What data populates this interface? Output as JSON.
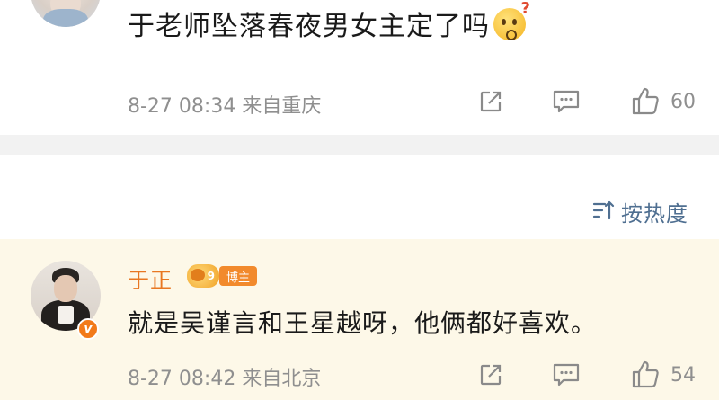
{
  "comments": [
    {
      "text": "于老师坠落春夜男女主定了吗",
      "emoji": "thinking-face-emoji",
      "meta": "8-27 08:34  来自重庆",
      "likes": "60"
    },
    {
      "user_name": "于正",
      "badge": "博主",
      "level_text": "9",
      "verified_text": "v",
      "text": "就是吴谨言和王星越呀，他俩都好喜欢。",
      "meta": "8-27 08:42  来自北京",
      "likes": "54"
    }
  ],
  "sort": {
    "label": "按热度"
  },
  "colors": {
    "divider": "#f2f2f2",
    "highlight_bg": "#fdf8e8",
    "username": "#e87722",
    "sort_text": "#4f6f91",
    "meta_text": "#8f8f8f"
  },
  "icons": [
    "share-icon",
    "comment-icon",
    "like-icon",
    "sort-icon",
    "verified-icon",
    "level-icon"
  ]
}
